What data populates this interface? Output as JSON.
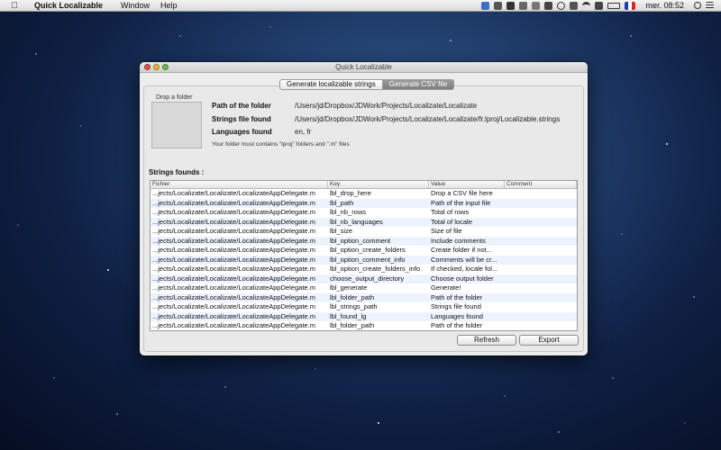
{
  "menubar": {
    "app_name": "Quick Localizable",
    "items": [
      "Window",
      "Help"
    ],
    "clock": "mer. 08:52"
  },
  "window": {
    "title": "Quick Localizable",
    "tabs": [
      {
        "label": "Generate localizable strings",
        "active": false
      },
      {
        "label": "Generate CSV file",
        "active": true
      }
    ],
    "drop_label": "Drop a folder",
    "path_label": "Path of the folder",
    "path_value": "/Users/jd/Dropbox/JDWork/Projects/Localizate/Localizate",
    "strings_label": "Strings file found",
    "strings_value": "/Users/jd/Dropbox/JDWork/Projects/Localizate/Localizate/fr.lproj/Localizable.strings",
    "languages_label": "Languages found",
    "languages_value": "en, fr",
    "hint": "Your folder must contains \"lproj\" folders and \".m\" files",
    "section_title": "Strings founds :",
    "columns": [
      "Fichier",
      "Key",
      "Value",
      "Comment"
    ],
    "rows": [
      [
        "...jects/Localizate/Localizate/LocalizateAppDelegate.m",
        "lbl_drop_here",
        "Drop a CSV file here",
        ""
      ],
      [
        "...jects/Localizate/Localizate/LocalizateAppDelegate.m",
        "lbl_path",
        "Path of the input file",
        ""
      ],
      [
        "...jects/Localizate/Localizate/LocalizateAppDelegate.m",
        "lbl_nb_rows",
        "Total of rows",
        ""
      ],
      [
        "...jects/Localizate/Localizate/LocalizateAppDelegate.m",
        "lbl_nb_languages",
        "Total of locale",
        ""
      ],
      [
        "...jects/Localizate/Localizate/LocalizateAppDelegate.m",
        "lbl_size",
        "Size of file",
        ""
      ],
      [
        "...jects/Localizate/Localizate/LocalizateAppDelegate.m",
        "lbl_option_comment",
        " Include comments",
        ""
      ],
      [
        "...jects/Localizate/Localizate/LocalizateAppDelegate.m",
        "lbl_option_create_folders",
        " Create folder if not...",
        ""
      ],
      [
        "...jects/Localizate/Localizate/LocalizateAppDelegate.m",
        "lbl_option_comment_info",
        "Comments will be cr...",
        ""
      ],
      [
        "...jects/Localizate/Localizate/LocalizateAppDelegate.m",
        "lbl_option_create_folders_info",
        "If checked, locale fol...",
        ""
      ],
      [
        "...jects/Localizate/Localizate/LocalizateAppDelegate.m",
        "choose_output_directory",
        "Choose output folder",
        ""
      ],
      [
        "...jects/Localizate/Localizate/LocalizateAppDelegate.m",
        "lbl_generate",
        "Generate!",
        ""
      ],
      [
        "...jects/Localizate/Localizate/LocalizateAppDelegate.m",
        "lbl_folder_path",
        "Path of the folder",
        ""
      ],
      [
        "...jects/Localizate/Localizate/LocalizateAppDelegate.m",
        "lbl_strings_path",
        "Strings file found",
        ""
      ],
      [
        "...jects/Localizate/Localizate/LocalizateAppDelegate.m",
        "lbl_found_lg",
        "Languages found",
        ""
      ],
      [
        "...jects/Localizate/Localizate/LocalizateAppDelegate.m",
        "lbl_folder_path",
        "Path of the folder",
        ""
      ]
    ],
    "refresh_label": "Refresh",
    "export_label": "Export"
  }
}
